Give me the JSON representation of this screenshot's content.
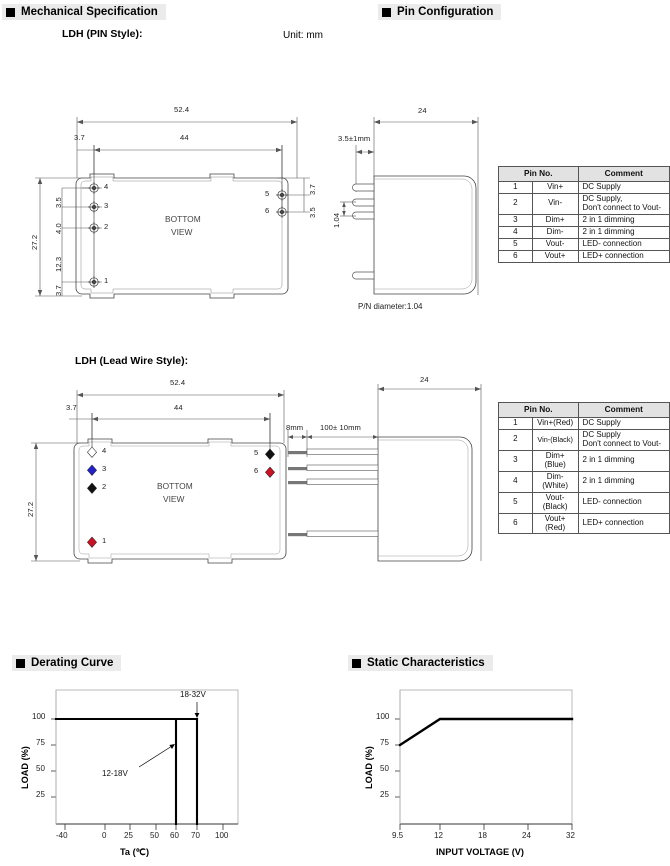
{
  "sections": {
    "mechanical": "Mechanical Specification",
    "pin_config": "Pin Configuration",
    "derating": "Derating Curve",
    "static": "Static Characteristics"
  },
  "unit_note": "Unit: mm",
  "drawings": {
    "pin_style": {
      "title": "LDH (PIN Style):",
      "bottom_view_line1": "BOTTOM",
      "bottom_view_line2": "VIEW",
      "dims": {
        "overall_width": "52.4",
        "inner_width": "44",
        "left_offset": "3.7",
        "overall_height": "27.2",
        "h_3_5": "3.5",
        "h_4_0": "4.0",
        "h_12_3": "12.3",
        "h_3_7": "3.7",
        "right_3_7": "3.7",
        "right_3_5": "3.5"
      },
      "pins": [
        "1",
        "2",
        "3",
        "4",
        "5",
        "6"
      ]
    },
    "pin_side": {
      "depth": "24",
      "pin_length": "3.5±1mm",
      "pin_pitch": "1.04",
      "pin_diameter_note": "P/N diameter:1.04"
    },
    "lead_style": {
      "title": "LDH (Lead Wire Style):",
      "bottom_view_line1": "BOTTOM",
      "bottom_view_line2": "VIEW",
      "dims": {
        "overall_width": "52.4",
        "inner_width": "44",
        "left_offset": "3.7",
        "overall_height": "27.2"
      },
      "pins": [
        {
          "no": "1",
          "color": "#cc1122"
        },
        {
          "no": "2",
          "color": "#111111"
        },
        {
          "no": "3",
          "color": "#2222cc"
        },
        {
          "no": "4",
          "color": "#ffffff"
        },
        {
          "no": "5",
          "color": "#111111"
        },
        {
          "no": "6",
          "color": "#cc1122"
        }
      ]
    },
    "lead_side": {
      "depth": "24",
      "strip_length": "8mm",
      "wire_length": "100± 10mm"
    }
  },
  "pin_table_pin": {
    "headers": [
      "Pin No.",
      "Comment"
    ],
    "rows": [
      {
        "no": "1",
        "name": "Vin+",
        "comment": "DC Supply"
      },
      {
        "no": "2",
        "name": "Vin-",
        "comment": "DC Supply,\nDon't connect to Vout-"
      },
      {
        "no": "3",
        "name": "Dim+",
        "comment": "2 in 1 dimming"
      },
      {
        "no": "4",
        "name": "Dim-",
        "comment": "2 in 1 dimming"
      },
      {
        "no": "5",
        "name": "Vout-",
        "comment": "LED- connection"
      },
      {
        "no": "6",
        "name": "Vout+",
        "comment": "LED+ connection"
      }
    ]
  },
  "pin_table_lead": {
    "headers": [
      "Pin No.",
      "Comment"
    ],
    "rows": [
      {
        "no": "1",
        "name": "Vin+(Red)",
        "comment": "DC Supply"
      },
      {
        "no": "2",
        "name": "Vin-(Black)",
        "comment": "DC Supply\nDon't connect to Vout-"
      },
      {
        "no": "3",
        "name": "Dim+\n(Blue)",
        "comment": "2 in 1 dimming"
      },
      {
        "no": "4",
        "name": "Dim-\n(White)",
        "comment": "2 in 1 dimming"
      },
      {
        "no": "5",
        "name": "Vout-\n(Black)",
        "comment": "LED- connection"
      },
      {
        "no": "6",
        "name": "Vout+\n(Red)",
        "comment": "LED+ connection"
      }
    ]
  },
  "chart_data": [
    {
      "type": "line",
      "title": "Derating Curve",
      "xlabel": "Ta (℃)",
      "ylabel": "LOAD (%)",
      "xlim": [
        -40,
        115
      ],
      "ylim": [
        0,
        120
      ],
      "xticks": [
        -40,
        0,
        25,
        50,
        60,
        70,
        100
      ],
      "xtick_labels": [
        "-40",
        "0",
        "25",
        "50",
        "60",
        "70",
        "100"
      ],
      "yticks": [
        25,
        50,
        75,
        100
      ],
      "ytick_labels": [
        "25",
        "50",
        "75",
        "100"
      ],
      "grid": false,
      "legend": "none",
      "annotations": [
        {
          "text": "18-32V",
          "x": 70,
          "y": 118
        },
        {
          "text": "12-18V",
          "x": 38,
          "y": 68
        }
      ],
      "series": [
        {
          "name": "12-18V",
          "points": [
            [
              -40,
              100
            ],
            [
              60,
              100
            ],
            [
              60,
              0
            ]
          ]
        },
        {
          "name": "18-32V",
          "points": [
            [
              -40,
              100
            ],
            [
              70,
              100
            ],
            [
              70,
              0
            ]
          ]
        }
      ]
    },
    {
      "type": "line",
      "title": "Static Characteristics",
      "xlabel": "INPUT VOLTAGE (V)",
      "ylabel": "LOAD (%)",
      "xlim": [
        9.5,
        32
      ],
      "ylim": [
        0,
        120
      ],
      "xticks": [
        9.5,
        12,
        18,
        24,
        32
      ],
      "xtick_labels": [
        "9.5",
        "12",
        "18",
        "24",
        "32"
      ],
      "yticks": [
        25,
        50,
        75,
        100
      ],
      "ytick_labels": [
        "25",
        "50",
        "75",
        "100"
      ],
      "grid": false,
      "legend": "none",
      "series": [
        {
          "name": "load",
          "points": [
            [
              9.5,
              75
            ],
            [
              12,
              100
            ],
            [
              32,
              100
            ]
          ]
        }
      ]
    }
  ]
}
